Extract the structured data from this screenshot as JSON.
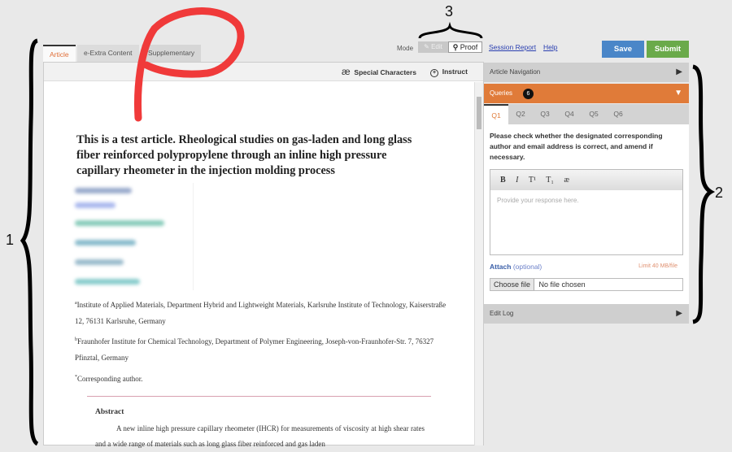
{
  "tabs": [
    {
      "label": "Article",
      "active": true
    },
    {
      "label": "e-Extra Content"
    },
    {
      "label": "Supplementary"
    }
  ],
  "mode": {
    "label": "Mode",
    "edit": "Edit",
    "proof": "Proof",
    "selected": "Proof"
  },
  "links": {
    "session_report": "Session Report",
    "help": "Help"
  },
  "buttons": {
    "save": "Save",
    "submit": "Submit"
  },
  "colors": {
    "save": "#4a86c8",
    "submit": "#6aaa4a",
    "queries": "#e07b39"
  },
  "toolbar": {
    "special_characters": "Special Characters",
    "special_icon": "æ",
    "instruct": "Instruct"
  },
  "article": {
    "title": "This is a test article. Rheological studies on gas-laden and long glass fiber reinforced polypropylene through an inline high pressure capillary rheometer in the injection molding process",
    "aff_a_sup": "a",
    "aff_a": "Institute of Applied Materials, Department Hybrid and Lightweight Materials, Karlsruhe Institute of Technology, Kaiserstraße 12, 76131 Karlsruhe, Germany",
    "aff_b_sup": "b",
    "aff_b": "Fraunhofer Institute for Chemical Technology, Department of Polymer Engineering, Joseph-von-Fraunhofer-Str. 7, 76327 Pfinztal, Germany",
    "corr_sup": "*",
    "corresponding": "Corresponding author.",
    "abstract_heading": "Abstract",
    "abstract_text": "A new inline high pressure capillary rheometer (IHCR) for measurements of viscosity at high shear rates and a wide range of materials such as long glass fiber reinforced and gas laden"
  },
  "panel": {
    "article_navigation": "Article Navigation",
    "queries": "Queries",
    "queries_count": "6",
    "query_tabs": [
      "Q1",
      "Q2",
      "Q3",
      "Q4",
      "Q5",
      "Q6"
    ],
    "query_text": "Please check whether the designated corresponding author and email address is correct, and amend if necessary.",
    "editor_buttons": [
      "B",
      "I",
      "T¹",
      "T₁",
      "æ"
    ],
    "response_placeholder": "Provide your response here.",
    "attach": "Attach",
    "attach_optional": "(optional)",
    "limit": "Limit 40 MB/file",
    "choose_file": "Choose file",
    "no_file": "No file chosen",
    "edit_log": "Edit Log"
  },
  "annotations": {
    "label1": "1",
    "label2": "2",
    "label3": "3"
  }
}
